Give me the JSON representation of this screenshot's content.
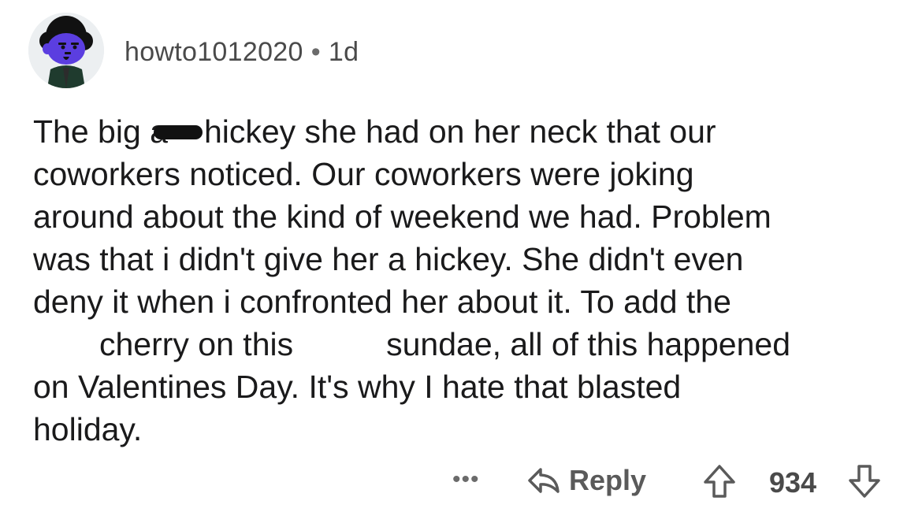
{
  "comment": {
    "username": "howto1012020",
    "separator": "•",
    "age": "1d",
    "avatar_icon": "snoo-avatar-icon",
    "body_lines": [
      {
        "before": "The big a",
        "after": "hickey she had on her neck that our"
      },
      "coworkers noticed.  Our coworkers were joking",
      "around about the kind of weekend we had.  Problem",
      "was that i didn't give her a hickey.  She didn't even",
      "deny it when i confronted her about it. To add the",
      {
        "part1": "cherry on this",
        "part2": "sundae, all of this happened"
      },
      "on Valentines Day.  It's why I hate that blasted",
      "holiday."
    ]
  },
  "actions": {
    "more": "•••",
    "reply_label": "Reply",
    "reply_icon": "reply-arrow-icon",
    "upvote_icon": "upvote-arrow-icon",
    "score": "934",
    "downvote_icon": "downvote-arrow-icon"
  },
  "colors": {
    "text": "#1a1a1b",
    "meta": "#4a4a4a",
    "avatar_bg": "#eceff1",
    "avatar_face": "#5b3ee0"
  }
}
